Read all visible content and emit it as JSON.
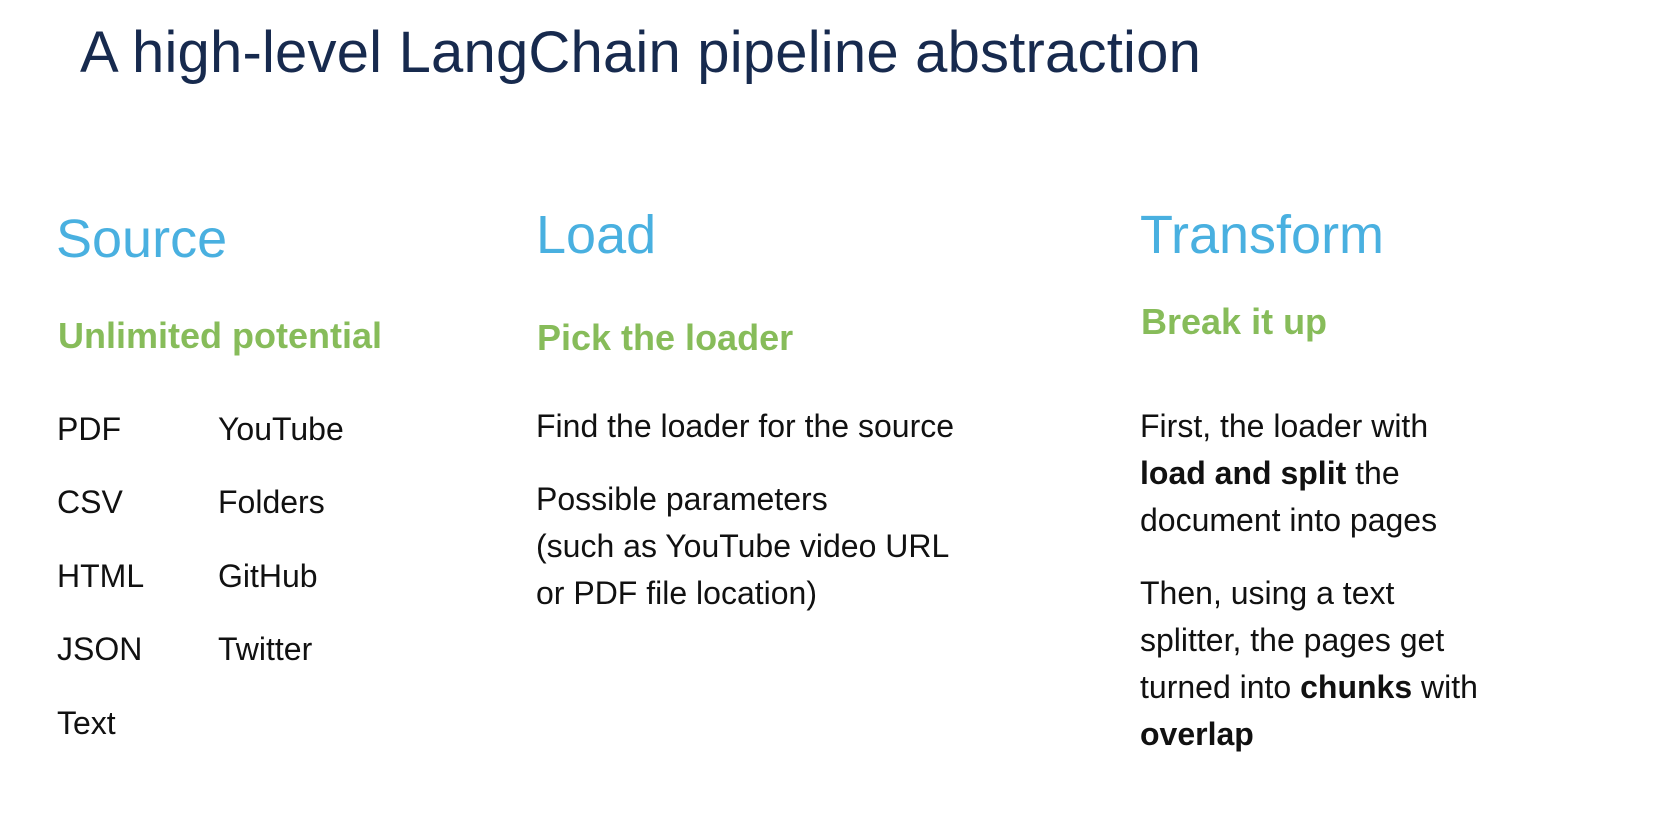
{
  "title": "A high-level LangChain pipeline abstraction",
  "columns": {
    "source": {
      "heading": "Source",
      "subheading": "Unlimited potential",
      "items_left": [
        "PDF",
        "CSV",
        "HTML",
        "JSON",
        "Text"
      ],
      "items_right": [
        "YouTube",
        "Folders",
        "GitHub",
        "Twitter"
      ]
    },
    "load": {
      "heading": "Load",
      "subheading": "Pick the loader",
      "paragraph1": "Find the loader for the source",
      "paragraph2_lines": [
        "Possible parameters",
        "(such as YouTube video URL",
        "or PDF file location)"
      ]
    },
    "transform": {
      "heading": "Transform",
      "subheading": "Break it up",
      "p1_line1": "First, the loader with",
      "p1_bold1": "load and split",
      "p1_after1": " the",
      "p1_line3": "document into pages",
      "p2_line1": "Then, using a text",
      "p2_line2": "splitter, the pages get",
      "p2_pre3": "turned into ",
      "p2_bold3": "chunks",
      "p2_after3": " with",
      "p2_bold4": "overlap"
    }
  },
  "colors": {
    "title": "#172a4e",
    "heading": "#49b0e0",
    "subheading": "#87bc5a",
    "body": "#111111"
  }
}
